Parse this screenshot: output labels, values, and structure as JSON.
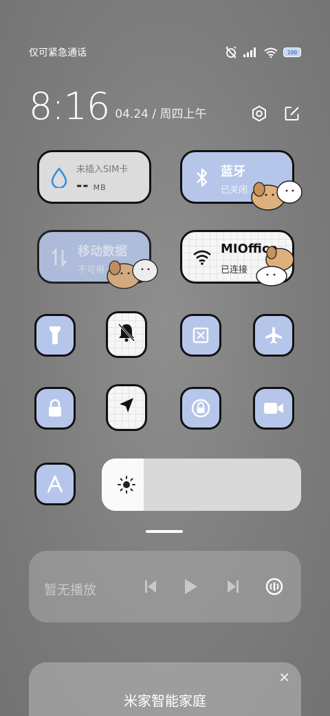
{
  "status": {
    "carrier": "仅可紧急通话",
    "battery": "100"
  },
  "clock": {
    "time": "8:16",
    "date": "04.24 / 周四上午"
  },
  "tiles": {
    "sim": {
      "title": "未插入SIM卡",
      "value": "--",
      "unit": "MB"
    },
    "bluetooth": {
      "title": "蓝牙",
      "status": "已关闭"
    },
    "mobile_data": {
      "title": "移动数据",
      "status": "不可用"
    },
    "wifi": {
      "title": "MIOffice",
      "status": "已连接"
    }
  },
  "small_tiles": [
    {
      "icon": "flashlight-icon"
    },
    {
      "icon": "mute-bell-icon"
    },
    {
      "icon": "screenshot-icon"
    },
    {
      "icon": "airplane-icon"
    },
    {
      "icon": "lock-icon"
    },
    {
      "icon": "location-icon"
    },
    {
      "icon": "rotation-lock-icon"
    },
    {
      "icon": "video-icon"
    },
    {
      "icon": "font-icon"
    }
  ],
  "brightness": {
    "level": 0.21
  },
  "media": {
    "label": "暂无播放"
  },
  "home_card": {
    "title": "米家智能家庭",
    "subtitle": ""
  },
  "colors": {
    "blue_tile": "#b6c6ea",
    "light_tile": "#dcdcdc",
    "white_tile": "#f6f6f6",
    "outline": "#111111"
  }
}
